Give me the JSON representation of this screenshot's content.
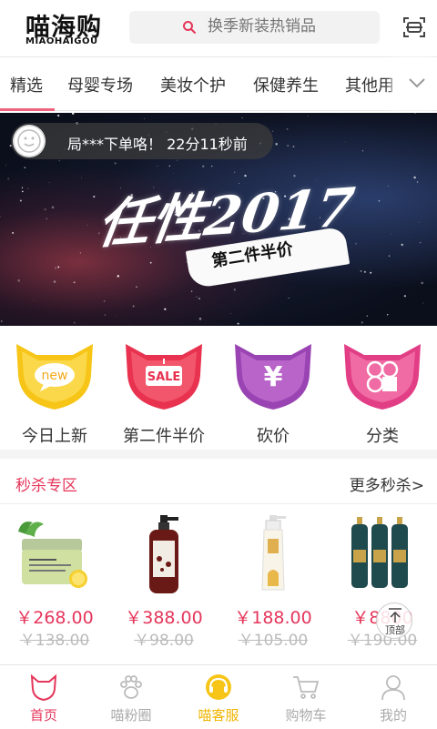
{
  "header": {
    "logo_cn": "喵海购",
    "logo_en": "MIAOHAIGOU",
    "search_placeholder": "换季新装热销品",
    "search_icon": "search-icon",
    "scan_icon": "scan-icon"
  },
  "tabs": {
    "items": [
      {
        "label": "精选",
        "active": true
      },
      {
        "label": "母婴专场"
      },
      {
        "label": "美妆个护"
      },
      {
        "label": "保健养生"
      },
      {
        "label": "其他用"
      }
    ],
    "active_color": "#f0627e",
    "more_icon": "chevron-down-icon"
  },
  "banner": {
    "notification": "局***下单咯！ 22分11秒前",
    "title": "任性2017",
    "subtitle": "第二件半价",
    "slide_count": 4,
    "active_slide": 4
  },
  "categories": [
    {
      "label": "今日上新",
      "badge": "new",
      "color": "#f7c517"
    },
    {
      "label": "第二件半价",
      "badge": "SALE",
      "color": "#ec3c5c"
    },
    {
      "label": "砍价",
      "badge": "¥",
      "color": "#a650b8"
    },
    {
      "label": "分类",
      "badge": "",
      "color": "#e94a8c"
    }
  ],
  "flash_sale": {
    "title": "秒杀专区",
    "more": "更多秒杀>",
    "products": [
      {
        "price": "￥268.00",
        "original": "￥138.00"
      },
      {
        "price": "￥388.00",
        "original": "￥98.00"
      },
      {
        "price": "￥188.00",
        "original": "￥105.00"
      },
      {
        "price": "￥8800",
        "original": "￥190.00"
      }
    ]
  },
  "back_to_top": {
    "label": "顶部"
  },
  "bottom_nav": [
    {
      "label": "首页",
      "active": true,
      "icon": "cat-home-icon"
    },
    {
      "label": "喵粉圈",
      "icon": "paw-icon"
    },
    {
      "label": "喵客服",
      "icon": "service-icon"
    },
    {
      "label": "购物车",
      "icon": "cart-icon"
    },
    {
      "label": "我的",
      "icon": "profile-icon"
    }
  ],
  "colors": {
    "accent": "#e5365b",
    "service": "#f7c517"
  }
}
